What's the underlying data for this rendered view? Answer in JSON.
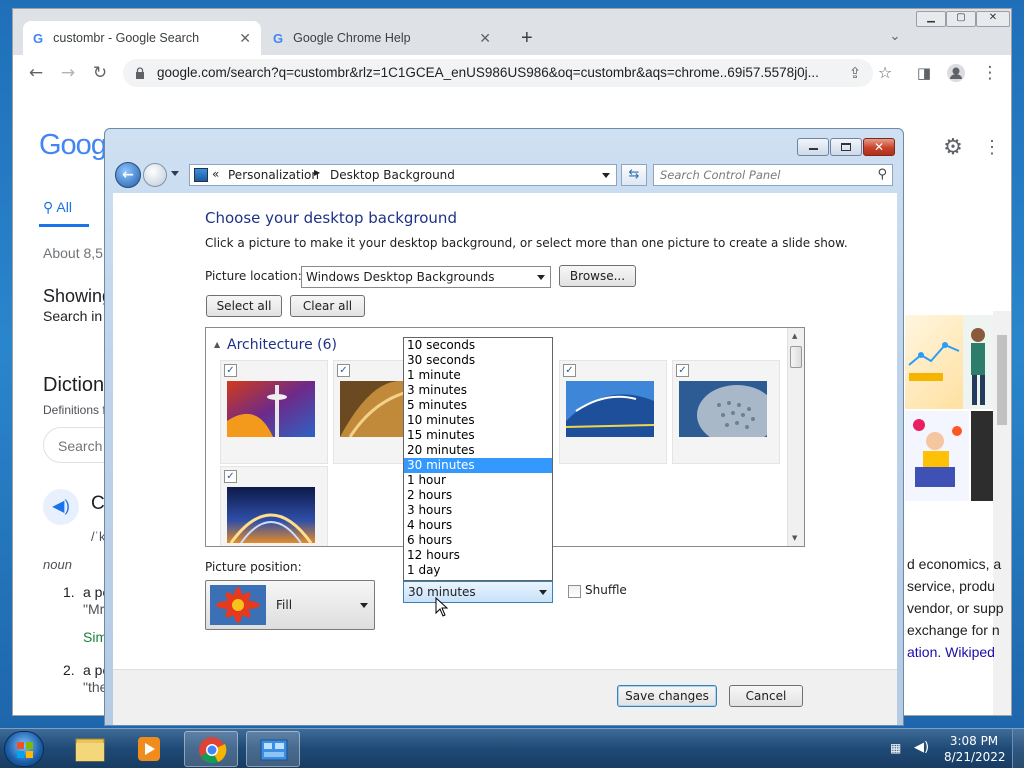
{
  "chrome": {
    "tabs": [
      {
        "title": "custombr - Google Search"
      },
      {
        "title": "Google Chrome Help"
      }
    ],
    "new_tab_label": "+",
    "url": "google.com/search?q=custombr&rlz=1C1GCEA_enUS986US986&oq=custombr&aqs=chrome..69i57.5578j0j..."
  },
  "google_page": {
    "logo_partial": "Goog",
    "all_tab": "All",
    "about_partial": "About 8,5",
    "showing_partial": "Showing",
    "search_in_partial": "Search in",
    "dictionary_partial": "Diction",
    "definitions_partial": "Definitions f",
    "search_box_partial": "Search",
    "word_partial": "C",
    "pron_partial": "/ˈk",
    "pos": "noun",
    "def1_num": "1.",
    "def1_partial": "a pe",
    "def1_quote_partial": "\"Mr",
    "similar_partial": "Sim",
    "def2_num": "2.",
    "def2_partial": "a pe",
    "def2_quote_partial": "\"the",
    "right_lines": [
      "d economics, a",
      "service, produ",
      "vendor, or supp",
      "exchange for n",
      "ation. Wikiped"
    ]
  },
  "dialog": {
    "breadcrumb_prefix": "«",
    "breadcrumb": [
      "Personalization",
      "Desktop Background"
    ],
    "search_placeholder": "Search Control Panel",
    "heading": "Choose your desktop background",
    "instruction": "Click a picture to make it your desktop background, or select more than one picture to create a slide show.",
    "picture_location_label": "Picture location:",
    "picture_location_value": "Windows Desktop Backgrounds",
    "browse_label": "Browse...",
    "select_all_label": "Select all",
    "clear_all_label": "Clear all",
    "group_title": "Architecture (6)",
    "picture_position_label": "Picture position:",
    "position_value": "Fill",
    "interval_value": "30 minutes",
    "interval_options": [
      "10 seconds",
      "30 seconds",
      "1 minute",
      "3 minutes",
      "5 minutes",
      "10 minutes",
      "15 minutes",
      "20 minutes",
      "30 minutes",
      "1 hour",
      "2 hours",
      "3 hours",
      "4 hours",
      "6 hours",
      "12 hours",
      "1 day"
    ],
    "selected_interval_index": 8,
    "shuffle_label": "Shuffle",
    "save_label": "Save changes",
    "cancel_label": "Cancel"
  },
  "taskbar": {
    "time": "3:08 PM",
    "date": "8/21/2022"
  }
}
